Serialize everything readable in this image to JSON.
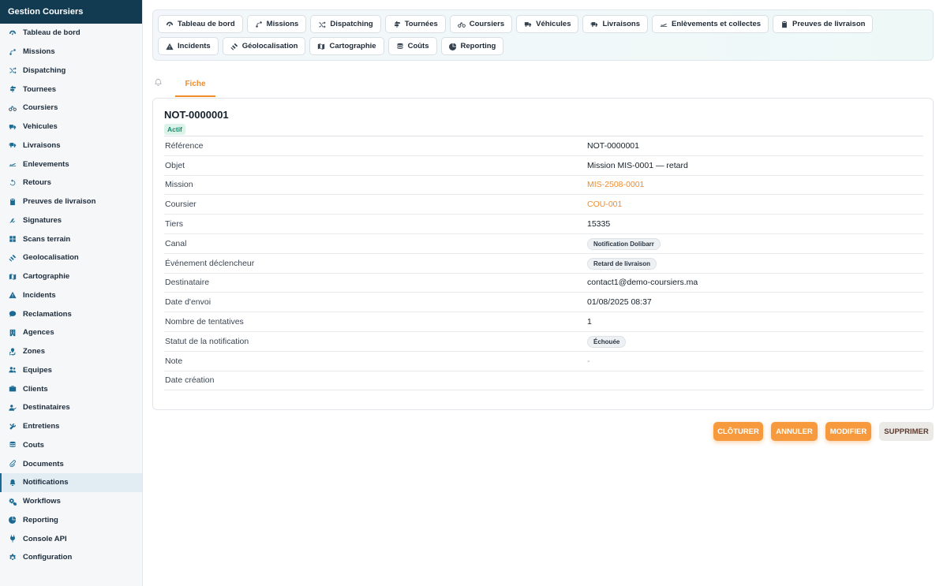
{
  "app": {
    "title": "Gestion Coursiers"
  },
  "sidebar": {
    "items": [
      {
        "label": "Tableau de bord",
        "icon": "dashboard-icon"
      },
      {
        "label": "Missions",
        "icon": "route-icon"
      },
      {
        "label": "Dispatching",
        "icon": "shuffle-icon"
      },
      {
        "label": "Tournees",
        "icon": "signpost-icon"
      },
      {
        "label": "Coursiers",
        "icon": "bicycle-icon"
      },
      {
        "label": "Vehicules",
        "icon": "truck-icon"
      },
      {
        "label": "Livraisons",
        "icon": "truck-fast-icon"
      },
      {
        "label": "Enlevements",
        "icon": "plane-icon"
      },
      {
        "label": "Retours",
        "icon": "rotate-left-icon"
      },
      {
        "label": "Preuves de livraison",
        "icon": "clipboard-check-icon"
      },
      {
        "label": "Signatures",
        "icon": "signature-icon"
      },
      {
        "label": "Scans terrain",
        "icon": "grid-icon"
      },
      {
        "label": "Geolocalisation",
        "icon": "satellite-icon"
      },
      {
        "label": "Cartographie",
        "icon": "map-icon"
      },
      {
        "label": "Incidents",
        "icon": "warning-icon"
      },
      {
        "label": "Reclamations",
        "icon": "comment-icon"
      },
      {
        "label": "Agences",
        "icon": "building-icon"
      },
      {
        "label": "Zones",
        "icon": "map-location-icon"
      },
      {
        "label": "Equipes",
        "icon": "users-icon"
      },
      {
        "label": "Clients",
        "icon": "briefcase-icon"
      },
      {
        "label": "Destinataires",
        "icon": "user-check-icon"
      },
      {
        "label": "Entretiens",
        "icon": "tools-icon"
      },
      {
        "label": "Couts",
        "icon": "coins-icon"
      },
      {
        "label": "Documents",
        "icon": "paperclip-icon"
      },
      {
        "label": "Notifications",
        "icon": "bell-icon",
        "active": true
      },
      {
        "label": "Workflows",
        "icon": "cogs-icon"
      },
      {
        "label": "Reporting",
        "icon": "pie-chart-icon"
      },
      {
        "label": "Console API",
        "icon": "plug-icon"
      },
      {
        "label": "Configuration",
        "icon": "gear-icon"
      }
    ]
  },
  "topnav": {
    "items": [
      {
        "label": "Tableau de bord",
        "icon": "dashboard-icon"
      },
      {
        "label": "Missions",
        "icon": "route-icon"
      },
      {
        "label": "Dispatching",
        "icon": "shuffle-icon"
      },
      {
        "label": "Tournées",
        "icon": "signpost-icon"
      },
      {
        "label": "Coursiers",
        "icon": "bicycle-icon"
      },
      {
        "label": "Véhicules",
        "icon": "truck-icon"
      },
      {
        "label": "Livraisons",
        "icon": "truck-fast-icon"
      },
      {
        "label": "Enlèvements et collectes",
        "icon": "plane-icon"
      },
      {
        "label": "Preuves de livraison",
        "icon": "clipboard-check-icon"
      },
      {
        "label": "Incidents",
        "icon": "warning-icon"
      },
      {
        "label": "Géolocalisation",
        "icon": "satellite-icon"
      },
      {
        "label": "Cartographie",
        "icon": "map-icon"
      },
      {
        "label": "Coûts",
        "icon": "coins-icon"
      },
      {
        "label": "Reporting",
        "icon": "pie-chart-icon"
      }
    ]
  },
  "tabs": {
    "notifications_icon": "bell-icon",
    "fiche": "Fiche"
  },
  "record": {
    "title": "NOT-0000001",
    "status": "Actif",
    "fields": [
      {
        "label": "Référence",
        "value": "NOT-0000001",
        "kind": "text"
      },
      {
        "label": "Objet",
        "value": "Mission MIS-0001 — retard",
        "kind": "text"
      },
      {
        "label": "Mission",
        "value": "MIS-2508-0001",
        "kind": "link"
      },
      {
        "label": "Coursier",
        "value": "COU-001",
        "kind": "link"
      },
      {
        "label": "Tiers",
        "value": "15335",
        "kind": "text"
      },
      {
        "label": "Canal",
        "value": "Notification Dolibarr",
        "kind": "pill"
      },
      {
        "label": "Événement déclencheur",
        "value": "Retard de livraison",
        "kind": "pill"
      },
      {
        "label": "Destinataire",
        "value": "contact1@demo-coursiers.ma",
        "kind": "text"
      },
      {
        "label": "Date d'envoi",
        "value": "01/08/2025 08:37",
        "kind": "text"
      },
      {
        "label": "Nombre de tentatives",
        "value": "1",
        "kind": "text"
      },
      {
        "label": "Statut de la notification",
        "value": "Échouée",
        "kind": "pill"
      },
      {
        "label": "Note",
        "value": "-",
        "kind": "dash"
      },
      {
        "label": "Date création",
        "value": "",
        "kind": "text"
      }
    ]
  },
  "actions": {
    "close": "CLÔTURER",
    "cancel": "ANNULER",
    "edit": "MODIFIER",
    "delete": "SUPPRIMER"
  },
  "colors": {
    "sidebar_header": "#123b52",
    "accent": "#f08c2c",
    "icon": "#1b6a93",
    "badge_active_bg": "#dcf3ea",
    "badge_active_text": "#17866a"
  }
}
